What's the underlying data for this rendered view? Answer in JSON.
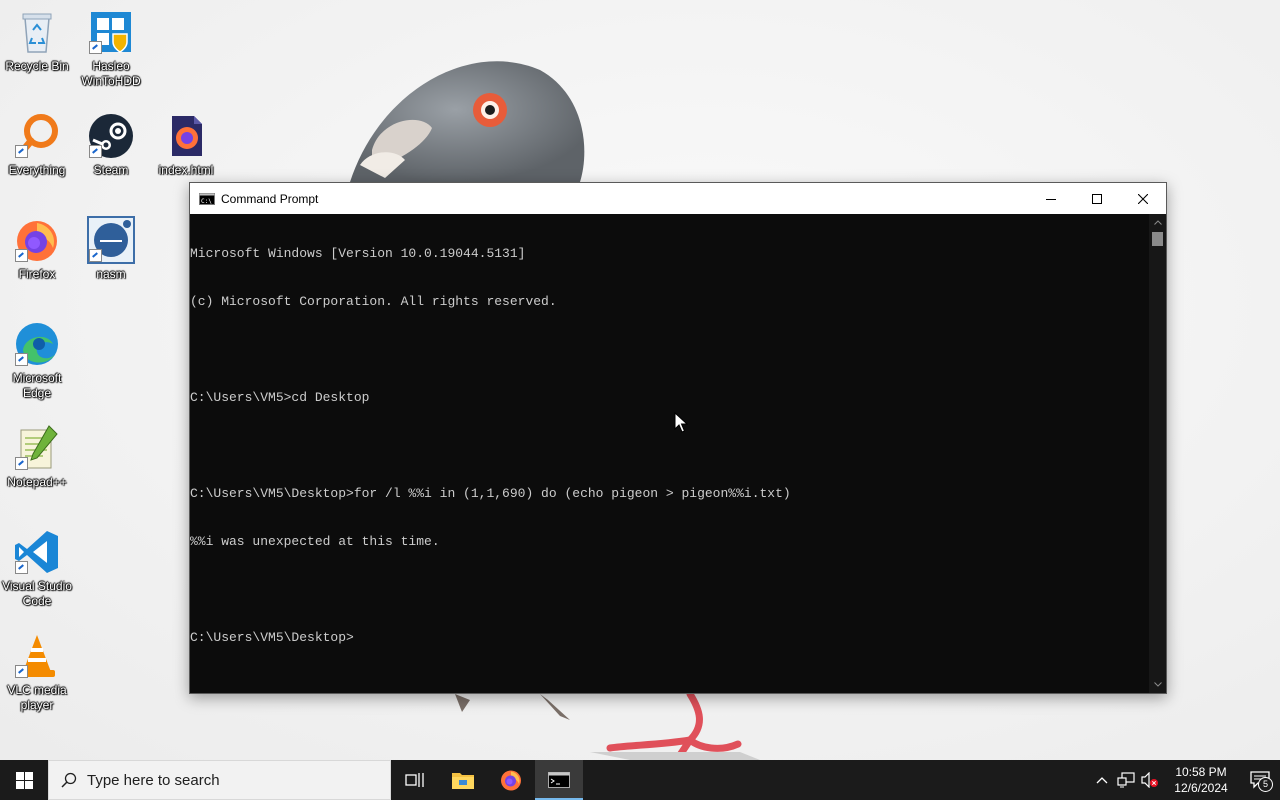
{
  "desktop": {
    "icons": [
      {
        "label": "Recycle Bin",
        "icon": "recycle-bin-icon"
      },
      {
        "label": "Hasleo WinToHDD",
        "icon": "wintohdd-icon"
      },
      {
        "label": "Everything",
        "icon": "everything-search-icon"
      },
      {
        "label": "Steam",
        "icon": "steam-icon"
      },
      {
        "label": "index.html",
        "icon": "firefox-html-file-icon"
      },
      {
        "label": "Firefox",
        "icon": "firefox-icon"
      },
      {
        "label": "nasm",
        "icon": "nasm-icon"
      },
      {
        "label": "Microsoft Edge",
        "icon": "edge-icon"
      },
      {
        "label": "Notepad++",
        "icon": "notepadpp-icon"
      },
      {
        "label": "Visual Studio Code",
        "icon": "vscode-icon"
      },
      {
        "label": "VLC media player",
        "icon": "vlc-icon"
      }
    ]
  },
  "cmd_window": {
    "title": "Command Prompt",
    "lines": [
      "Microsoft Windows [Version 10.0.19044.5131]",
      "(c) Microsoft Corporation. All rights reserved.",
      "",
      "C:\\Users\\VM5>cd Desktop",
      "",
      "C:\\Users\\VM5\\Desktop>for /l %%i in (1,1,690) do (echo pigeon > pigeon%%i.txt)",
      "%%i was unexpected at this time.",
      "",
      "C:\\Users\\VM5\\Desktop>"
    ]
  },
  "taskbar": {
    "search_placeholder": "Type here to search",
    "apps": [
      "task-view-icon",
      "file-explorer-icon",
      "firefox-icon",
      "command-prompt-icon"
    ],
    "active_app": "command-prompt-icon",
    "clock_time": "10:58 PM",
    "clock_date": "12/6/2024",
    "notification_count": "5"
  },
  "colors": {
    "terminal_bg": "#0c0c0c",
    "terminal_fg": "#cccccc",
    "taskbar_bg": "#1b1b1b",
    "accent": "#76b9ed"
  }
}
